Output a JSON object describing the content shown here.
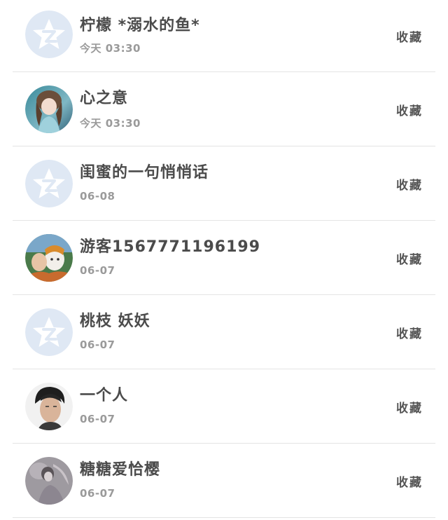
{
  "list": {
    "items": [
      {
        "name": "柠檬 *溺水的鱼*",
        "time": "今天 03:30",
        "action": "收藏",
        "avatar": "default-qzone-avatar"
      },
      {
        "name": "心之意",
        "time": "今天 03:30",
        "action": "收藏",
        "avatar": "anime-girl-avatar"
      },
      {
        "name": "闺蜜的一句悄悄话",
        "time": "06-08",
        "action": "收藏",
        "avatar": "default-qzone-avatar"
      },
      {
        "name": "游客1567771196199",
        "time": "06-07",
        "action": "收藏",
        "avatar": "child-photo-avatar"
      },
      {
        "name": "桃枝 妖妖",
        "time": "06-07",
        "action": "收藏",
        "avatar": "default-qzone-avatar"
      },
      {
        "name": "一个人",
        "time": "06-07",
        "action": "收藏",
        "avatar": "man-portrait-avatar"
      },
      {
        "name": "糖糖爱恰樱",
        "time": "06-07",
        "action": "收藏",
        "avatar": "girl-photo-avatar"
      }
    ]
  },
  "colors": {
    "name_text": "#4b4b4b",
    "time_text": "#9a9a9a",
    "action_text": "#555555",
    "divider": "#e4e4e4",
    "default_avatar_bg": "#dfe8f4"
  }
}
